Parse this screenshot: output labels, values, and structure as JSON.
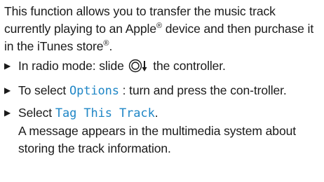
{
  "intro": {
    "part1": "This function allows you to transfer the music track currently playing to an Apple",
    "sup1": "®",
    "part2": " device and then purchase it in the iTunes store",
    "sup2": "®",
    "part3": "."
  },
  "steps": [
    {
      "before": "In radio mode: slide ",
      "icon": "controller-slide-down-icon",
      "after": " the controller."
    },
    {
      "before": "To select ",
      "display": "Options",
      "after": " : turn and press the con-troller."
    },
    {
      "before": "Select ",
      "display": "Tag This Track",
      "after": ".",
      "result": "A message appears in the multimedia system about storing the track information."
    }
  ],
  "colors": {
    "display_text": "#1f86c6",
    "body_text": "#1a1a1a"
  },
  "icons": {
    "bullet": "triangle-bullet-icon",
    "controller": "controller-slide-down-icon"
  }
}
